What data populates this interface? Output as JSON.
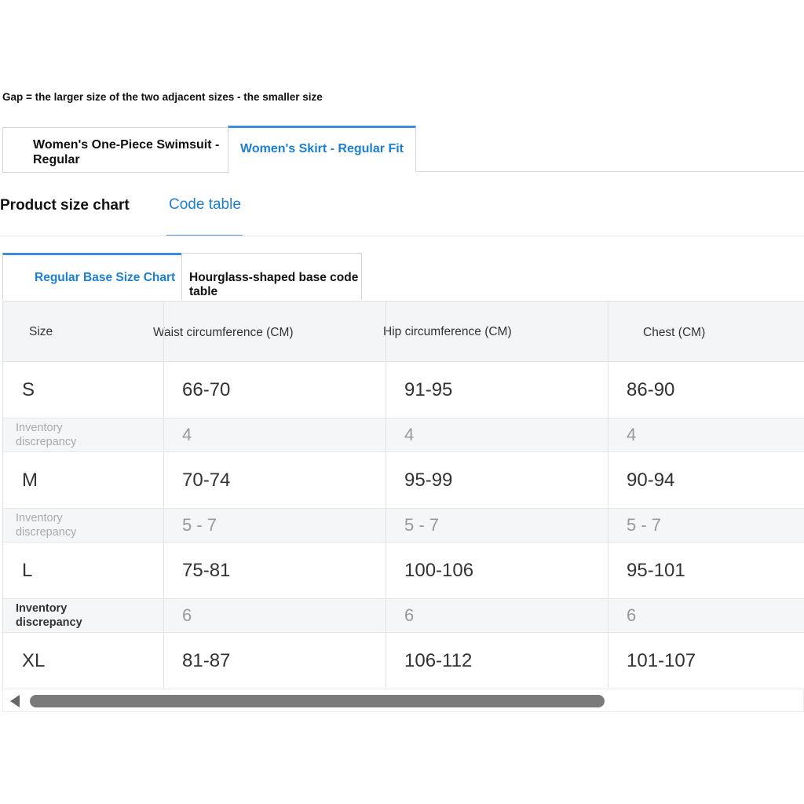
{
  "note": "Gap = the larger size of the two adjacent sizes - the smaller size",
  "product_tabs": [
    {
      "label_line1": "Women's One-Piece Swimsuit -",
      "label_line2": "Regular",
      "active": false
    },
    {
      "label": "Women's Skirt - Regular Fit",
      "active": true
    }
  ],
  "section": {
    "title": "Product size chart",
    "code_tab": "Code table"
  },
  "base_tabs": [
    {
      "label": "Regular Base Size Chart",
      "active": true
    },
    {
      "label": "Hourglass-shaped base code table",
      "active": false
    }
  ],
  "table": {
    "headers": [
      "Size",
      "Waist circumference (CM)",
      "Hip circumference (CM)",
      "Chest (CM)"
    ],
    "gap_label_line1": "Inventory",
    "gap_label_line2": "discrepancy",
    "rows": [
      {
        "size": "S",
        "waist": "66-70",
        "hip": "91-95",
        "chest": "86-90"
      },
      {
        "gap": true,
        "waist": "4",
        "hip": "4",
        "chest": "4"
      },
      {
        "size": "M",
        "waist": "70-74",
        "hip": "95-99",
        "chest": "90-94"
      },
      {
        "gap": true,
        "waist": "5 - 7",
        "hip": "5 - 7",
        "chest": "5 - 7"
      },
      {
        "size": "L",
        "waist": "75-81",
        "hip": "100-106",
        "chest": "95-101"
      },
      {
        "gap": true,
        "waist": "6",
        "hip": "6",
        "chest": "6"
      },
      {
        "size": "XL",
        "waist": "81-87",
        "hip": "106-112",
        "chest": "101-107"
      }
    ]
  },
  "colors": {
    "accent": "#1b7fd6",
    "tab_indicator": "#3b8de0",
    "scrollbar_thumb": "#7a7a7a"
  },
  "icons": {
    "scroll_left": "caret-left-icon"
  }
}
